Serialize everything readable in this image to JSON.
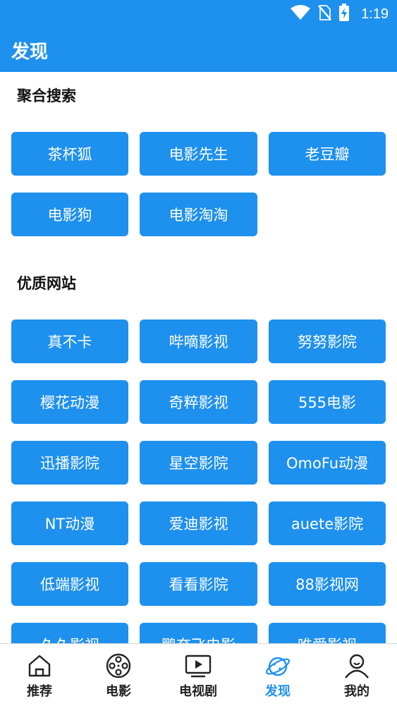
{
  "status_bar": {
    "time": "1:19"
  },
  "app_bar": {
    "title": "发现"
  },
  "sections": {
    "aggregate_search": {
      "title": "聚合搜索",
      "items": [
        "茶杯狐",
        "电影先生",
        "老豆瓣",
        "电影狗",
        "电影淘淘"
      ]
    },
    "quality_sites": {
      "title": "优质网站",
      "items": [
        "真不卡",
        "哔嘀影视",
        "努努影院",
        "樱花动漫",
        "奇粹影视",
        "555电影",
        "迅播影院",
        "星空影院",
        "OmoFu动漫",
        "NT动漫",
        "爱迪影视",
        "auete影院",
        "低端影视",
        "看看影院",
        "88影视网",
        "久久影视",
        "鹏奈飞电影",
        "唯爱影视"
      ]
    }
  },
  "bottom_nav": {
    "items": [
      {
        "label": "推荐",
        "icon": "home-icon"
      },
      {
        "label": "电影",
        "icon": "film-reel-icon"
      },
      {
        "label": "电视剧",
        "icon": "tv-icon"
      },
      {
        "label": "发现",
        "icon": "planet-icon"
      },
      {
        "label": "我的",
        "icon": "person-icon"
      }
    ],
    "active": "发现",
    "active_color": "#1e90ee"
  },
  "colors": {
    "primary": "#1e90ee"
  }
}
